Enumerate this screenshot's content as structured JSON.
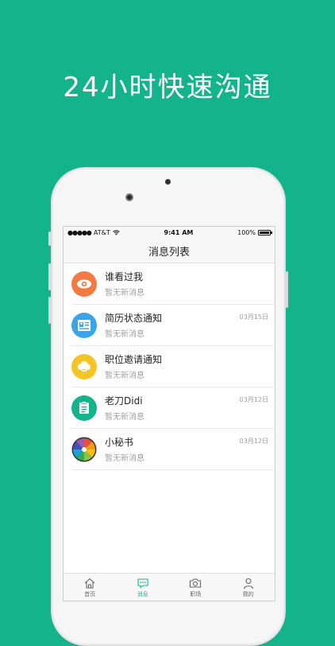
{
  "headline": "24小时快速沟通",
  "status_bar": {
    "carrier": "AT&T",
    "time": "9:41 AM",
    "battery": "100%"
  },
  "nav_title": "消息列表",
  "messages": [
    {
      "title": "谁看过我",
      "subtitle": "暂无新消息",
      "date": "",
      "icon": "eye-icon",
      "color": "#f47a44"
    },
    {
      "title": "简历状态通知",
      "subtitle": "暂无新消息",
      "date": "03月15日",
      "icon": "resume-card-icon",
      "color": "#3aa4e6"
    },
    {
      "title": "职位邀请通知",
      "subtitle": "暂无新消息",
      "date": "",
      "icon": "cloud-icon",
      "color": "#f5c425"
    },
    {
      "title": "老刀Didi",
      "subtitle": "暂无新消息",
      "date": "03月12日",
      "icon": "clipboard-icon",
      "color": "#13b38b"
    },
    {
      "title": "小秘书",
      "subtitle": "暂无新消息",
      "date": "03月12日",
      "icon": "color-wheel-icon",
      "color": "#ffffff"
    }
  ],
  "tabs": [
    {
      "label": "首页",
      "icon": "home-icon",
      "active": false
    },
    {
      "label": "消息",
      "icon": "message-icon",
      "active": true
    },
    {
      "label": "职场",
      "icon": "camera-icon",
      "active": false
    },
    {
      "label": "我的",
      "icon": "user-icon",
      "active": false
    }
  ],
  "colors": {
    "background": "#13b38b",
    "accent": "#13b38b"
  }
}
